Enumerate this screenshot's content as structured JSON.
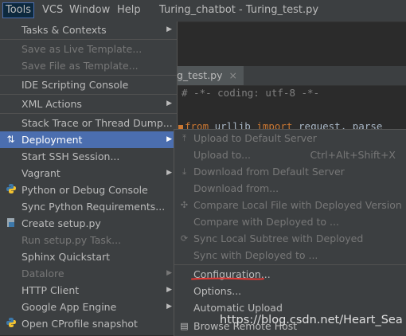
{
  "menubar": {
    "items": [
      {
        "label": "Tools"
      },
      {
        "label": "VCS"
      },
      {
        "label": "Window"
      },
      {
        "label": "Help"
      }
    ],
    "window_title": "Turing_chatbot - Turing_test.py"
  },
  "editor": {
    "tab_label": "g_test.py",
    "close_glyph": "×",
    "lines": [
      {
        "parts": [
          "# -*- coding: utf-8 -*-"
        ]
      },
      {
        "parts": [
          "from",
          "urllib",
          "import",
          "request",
          "parse"
        ]
      }
    ]
  },
  "tools_menu": {
    "items": [
      {
        "label": "Tasks & Contexts"
      },
      {
        "label": "Save as Live Template..."
      },
      {
        "label": "Save File as Template..."
      },
      {
        "label": "IDE Scripting Console"
      },
      {
        "label": "XML Actions"
      },
      {
        "label": "Stack Trace or Thread Dump..."
      },
      {
        "label": "Deployment"
      },
      {
        "label": "Start SSH Session..."
      },
      {
        "label": "Vagrant"
      },
      {
        "label": "Python or Debug Console"
      },
      {
        "label": "Sync Python Requirements..."
      },
      {
        "label": "Create setup.py"
      },
      {
        "label": "Run setup.py Task..."
      },
      {
        "label": "Sphinx Quickstart"
      },
      {
        "label": "Datalore"
      },
      {
        "label": "HTTP Client"
      },
      {
        "label": "Google App Engine"
      },
      {
        "label": "Open CProfile snapshot"
      }
    ]
  },
  "deployment_submenu": {
    "items": [
      {
        "label": "Upload to Default Server"
      },
      {
        "label": "Upload to...",
        "shortcut": "Ctrl+Alt+Shift+X"
      },
      {
        "label": "Download from Default Server"
      },
      {
        "label": "Download from..."
      },
      {
        "label": "Compare Local File with Deployed Version"
      },
      {
        "label": "Compare with Deployed to ..."
      },
      {
        "label": "Sync Local Subtree with Deployed"
      },
      {
        "label": "Sync with Deployed to ..."
      },
      {
        "label": "Configuration..."
      },
      {
        "label": "Options..."
      },
      {
        "label": "Automatic Upload"
      },
      {
        "label": "Browse Remote Host"
      }
    ]
  },
  "watermark": "https://blog.csdn.net/Heart_Sea",
  "colors": {
    "selected": "#4b6eaf",
    "menu_bg": "#3c3f41",
    "annotation_underline": "#e53935"
  }
}
